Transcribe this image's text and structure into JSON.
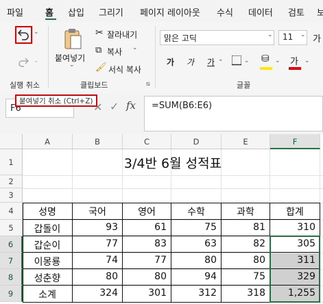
{
  "menu": {
    "items": [
      "파일",
      "홈",
      "삽입",
      "그리기",
      "페이지 레이아웃",
      "수식",
      "데이터",
      "검토",
      "보"
    ],
    "active": "홈"
  },
  "ribbon": {
    "undo_group_label": "실행 취소",
    "clipboard": {
      "label": "클립보드",
      "paste": "붙여넣기",
      "cut": "잘라내기",
      "copy": "복사",
      "format_painter": "서식 복사"
    },
    "font": {
      "label": "글꼴",
      "font_name": "맑은 고딕",
      "font_size": "11",
      "bold": "가",
      "italic": "가",
      "underline": "가",
      "font_color_letter": "가"
    },
    "colors": {
      "accent": "#217346",
      "highlight": "#e00000",
      "fill_yellow": "#ffe800"
    }
  },
  "tooltip": "붙여넣기 취소 (Ctrl+Z)",
  "formula_bar": {
    "name_box": "F6",
    "fx": "fx",
    "formula": "=SUM(B6:E6)"
  },
  "sheet": {
    "columns": [
      "A",
      "B",
      "C",
      "D",
      "E",
      "F"
    ],
    "selected_column": "F",
    "rows": [
      "1",
      "2",
      "3",
      "4",
      "5",
      "6",
      "7",
      "8",
      "9"
    ],
    "selected_rows": [
      "6",
      "7",
      "8",
      "9"
    ],
    "title": "3/4반 6월 성적표",
    "headers": [
      "성명",
      "국어",
      "영어",
      "수학",
      "과학",
      "합계"
    ],
    "data": [
      [
        "갑돌이",
        "93",
        "61",
        "75",
        "81",
        "310"
      ],
      [
        "갑순이",
        "77",
        "83",
        "63",
        "82",
        "305"
      ],
      [
        "이몽룡",
        "74",
        "77",
        "80",
        "80",
        "311"
      ],
      [
        "성춘향",
        "80",
        "80",
        "94",
        "75",
        "329"
      ],
      [
        "소계",
        "324",
        "301",
        "312",
        "318",
        "1,255"
      ]
    ]
  }
}
